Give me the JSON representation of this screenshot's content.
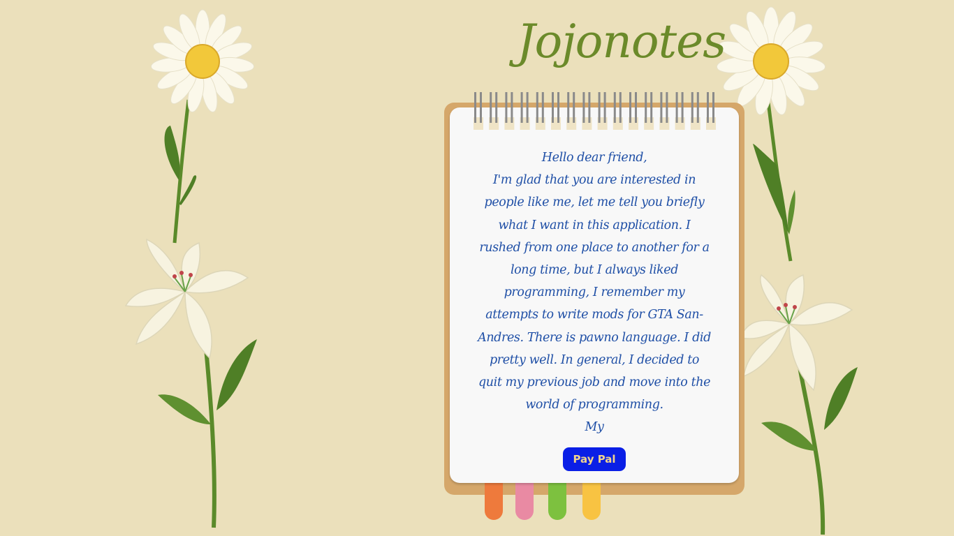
{
  "app": {
    "title": "Jojonotes"
  },
  "note": {
    "lines": [
      "Hello dear friend,",
      "I'm glad that you are interested in",
      "people like me, let me tell you briefly",
      "what I want in this application. I",
      "rushed from one place to another for a",
      "long time, but I always liked",
      "programming, I remember my",
      "attempts to write mods for GTA San-",
      "Andres. There is pawno language. I did",
      "pretty well. In general, I decided to",
      "quit my previous job and move into the",
      "world of programming.",
      "My"
    ]
  },
  "actions": {
    "paypal_label": "Pay Pal"
  },
  "tabs": {
    "colors": [
      "#ee7a3c",
      "#e98aa3",
      "#7dc13f",
      "#f8c342"
    ]
  },
  "icons": {
    "flowers": [
      "daisy-icon",
      "lily-icon"
    ]
  }
}
